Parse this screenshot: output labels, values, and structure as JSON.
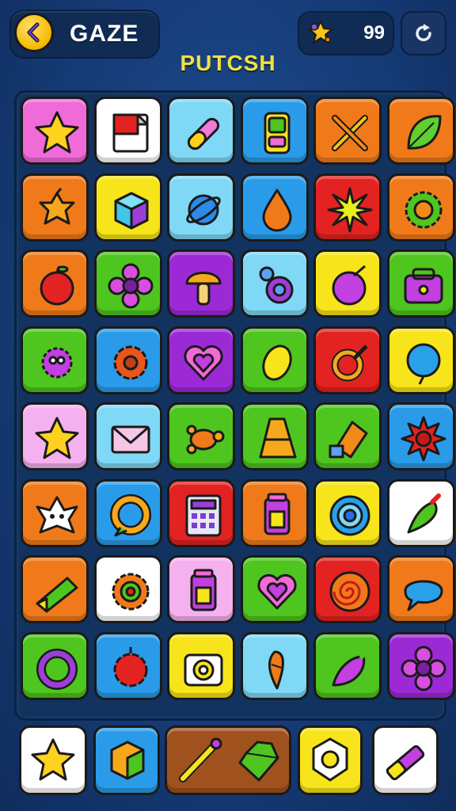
{
  "header": {
    "title": "GAZE",
    "score": "99",
    "subtitle": "PUTCSH"
  },
  "icons": {
    "back": "back-arrow-icon",
    "score": "star-score-icon",
    "refresh": "refresh-icon"
  },
  "colors": {
    "pink": "#f06ad8",
    "white": "#ffffff",
    "lightblue": "#7fd8f5",
    "blue": "#2a9be8",
    "orange": "#f07a1a",
    "yellow": "#f7e41a",
    "red": "#e32222",
    "green": "#4fc51f",
    "purple": "#9b2ad6",
    "lightpink": "#f5b0f0",
    "brown": "#a0521e"
  },
  "board": {
    "rows": [
      [
        {
          "bg": "pink",
          "icon": "star"
        },
        {
          "bg": "white",
          "icon": "page"
        },
        {
          "bg": "lightblue",
          "icon": "pill"
        },
        {
          "bg": "blue",
          "icon": "phone"
        },
        {
          "bg": "orange",
          "icon": "tools"
        },
        {
          "bg": "orange",
          "icon": "leaf"
        }
      ],
      [
        {
          "bg": "orange",
          "icon": "fruit-star"
        },
        {
          "bg": "yellow",
          "icon": "cube"
        },
        {
          "bg": "lightblue",
          "icon": "orbit"
        },
        {
          "bg": "blue",
          "icon": "drop"
        },
        {
          "bg": "red",
          "icon": "burst"
        },
        {
          "bg": "orange",
          "icon": "gear"
        }
      ],
      [
        {
          "bg": "orange",
          "icon": "apple"
        },
        {
          "bg": "green",
          "icon": "flower"
        },
        {
          "bg": "purple",
          "icon": "mushroom"
        },
        {
          "bg": "lightblue",
          "icon": "snail"
        },
        {
          "bg": "yellow",
          "icon": "orb"
        },
        {
          "bg": "green",
          "icon": "bag"
        }
      ],
      [
        {
          "bg": "green",
          "icon": "virus"
        },
        {
          "bg": "blue",
          "icon": "blob"
        },
        {
          "bg": "purple",
          "icon": "heart"
        },
        {
          "bg": "green",
          "icon": "lemon"
        },
        {
          "bg": "red",
          "icon": "ring"
        },
        {
          "bg": "yellow",
          "icon": "balloon"
        }
      ],
      [
        {
          "bg": "lightpink",
          "icon": "star"
        },
        {
          "bg": "lightblue",
          "icon": "envelope"
        },
        {
          "bg": "green",
          "icon": "turtle"
        },
        {
          "bg": "green",
          "icon": "cone"
        },
        {
          "bg": "green",
          "icon": "brush"
        },
        {
          "bg": "blue",
          "icon": "sun"
        }
      ],
      [
        {
          "bg": "orange",
          "icon": "critter"
        },
        {
          "bg": "blue",
          "icon": "chat-ring"
        },
        {
          "bg": "red",
          "icon": "calculator"
        },
        {
          "bg": "orange",
          "icon": "jar"
        },
        {
          "bg": "yellow",
          "icon": "target"
        },
        {
          "bg": "white",
          "icon": "pepper"
        }
      ],
      [
        {
          "bg": "orange",
          "icon": "prism"
        },
        {
          "bg": "white",
          "icon": "gear-target"
        },
        {
          "bg": "lightpink",
          "icon": "jar"
        },
        {
          "bg": "green",
          "icon": "heart"
        },
        {
          "bg": "red",
          "icon": "spiral"
        },
        {
          "bg": "orange",
          "icon": "bubble"
        }
      ],
      [
        {
          "bg": "green",
          "icon": "ring-open"
        },
        {
          "bg": "blue",
          "icon": "berry"
        },
        {
          "bg": "yellow",
          "icon": "camera"
        },
        {
          "bg": "lightblue",
          "icon": "carrot"
        },
        {
          "bg": "green",
          "icon": "eggplant"
        },
        {
          "bg": "purple",
          "icon": "flower"
        }
      ]
    ]
  },
  "tray": [
    {
      "bg": "white",
      "icon": "star"
    },
    {
      "bg": "blue",
      "icon": "box"
    },
    {
      "bg": "brown",
      "icon": "pencil"
    },
    {
      "bg": "yellow",
      "icon": "badge"
    },
    {
      "bg": "white",
      "icon": "crayon"
    }
  ]
}
